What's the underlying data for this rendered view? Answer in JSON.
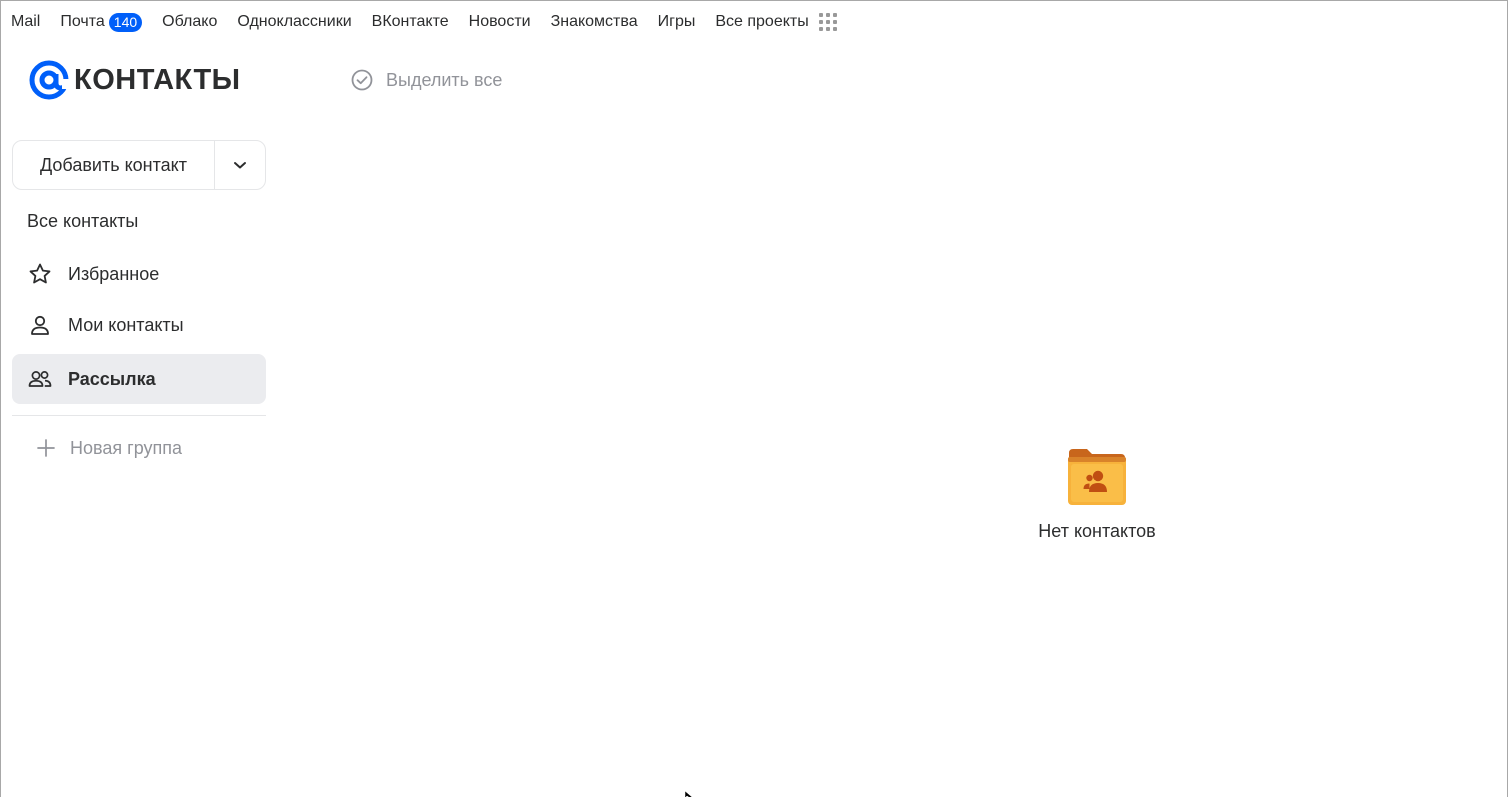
{
  "topnav": {
    "items": [
      {
        "label": "Mail"
      },
      {
        "label": "Почта",
        "badge": "140"
      },
      {
        "label": "Облако"
      },
      {
        "label": "Одноклассники"
      },
      {
        "label": "ВКонтакте"
      },
      {
        "label": "Новости"
      },
      {
        "label": "Знакомства"
      },
      {
        "label": "Игры"
      },
      {
        "label": "Все проекты"
      }
    ],
    "apps_icon": "grid-icon"
  },
  "logo": {
    "text": "КОНТАКТЫ",
    "icon": "at-sign-icon"
  },
  "toolbar": {
    "select_all": "Выделить все"
  },
  "sidebar": {
    "add_contact": "Добавить контакт",
    "all_contacts": "Все контакты",
    "items": [
      {
        "label": "Избранное",
        "icon": "star-icon"
      },
      {
        "label": "Мои контакты",
        "icon": "user-icon"
      },
      {
        "label": "Рассылка",
        "icon": "users-icon",
        "active": true
      }
    ],
    "new_group": "Новая группа"
  },
  "empty_state": {
    "label": "Нет контактов",
    "icon": "contacts-folder-icon"
  },
  "colors": {
    "accent": "#005ff9",
    "active_bg": "#ebecef",
    "muted": "#919399",
    "folder": "#f7b23b"
  }
}
